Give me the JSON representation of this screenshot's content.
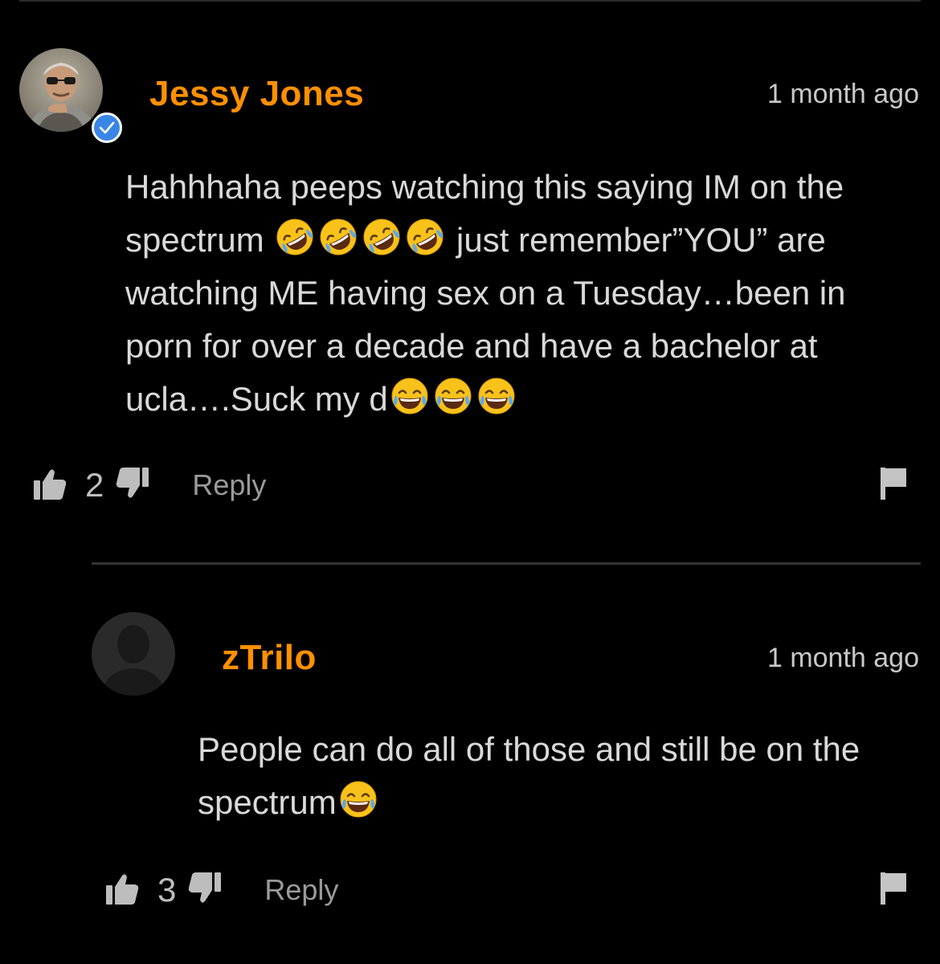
{
  "comments": [
    {
      "username": "Jessy Jones",
      "verified": true,
      "timestamp": "1 month ago",
      "text_parts": {
        "p1": "Hahhhaha peeps watching this saying IM on the spectrum ",
        "p2": " just remember”YOU” are watching ME having sex on a Tuesday…been in porn for over a decade and have a bachelor at ucla….Suck my d"
      },
      "emoji_run_1": [
        "rolling-on-floor-laughing",
        "rolling-on-floor-laughing",
        "rolling-on-floor-laughing",
        "rolling-on-floor-laughing"
      ],
      "emoji_run_2": [
        "face-with-tears-of-joy",
        "face-with-tears-of-joy",
        "face-with-tears-of-joy"
      ],
      "likes": "2",
      "reply_label": "Reply"
    },
    {
      "username": "zTrilo",
      "verified": false,
      "timestamp": "1 month ago",
      "text_parts": {
        "p1": "People can do all of those and still be on the spectrum"
      },
      "emoji_run_1": [
        "face-with-tears-of-joy"
      ],
      "likes": "3",
      "reply_label": "Reply"
    }
  ],
  "colors": {
    "background": "#000000",
    "username": "#ff9000",
    "text": "#d9d9d9",
    "verified_badge": "#3a86e6",
    "separator": "#333333"
  },
  "icons": {
    "like": "thumbs-up-icon",
    "dislike": "thumbs-down-icon",
    "flag": "flag-icon",
    "verified": "checkmark-icon"
  }
}
